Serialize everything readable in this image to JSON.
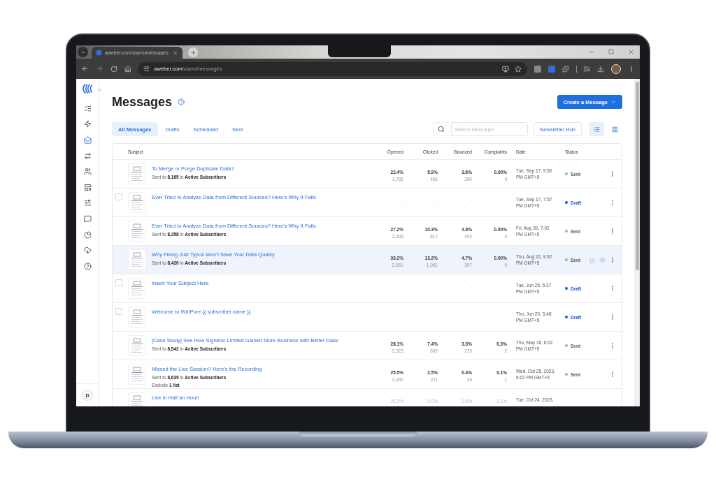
{
  "browser": {
    "tab_title": "aweber.com/users/messages",
    "url_host": "aweber.com",
    "url_path": "/users/messages"
  },
  "sidebar": {
    "items": [
      {
        "selected": false
      },
      {
        "selected": false
      },
      {
        "selected": true
      },
      {
        "selected": false
      },
      {
        "selected": false
      },
      {
        "selected": false
      },
      {
        "selected": false
      },
      {
        "selected": false
      },
      {
        "selected": false
      },
      {
        "selected": false
      },
      {
        "selected": false
      }
    ],
    "avatar": "D"
  },
  "page": {
    "title": "Messages",
    "create_button": "Create a Message"
  },
  "tabs": [
    {
      "label": "All Messages",
      "selected": true
    },
    {
      "label": "Drafts",
      "selected": false
    },
    {
      "label": "Scheduled",
      "selected": false
    },
    {
      "label": "Sent",
      "selected": false
    }
  ],
  "search": {
    "placeholder": "Search Messages"
  },
  "newsletter_button": "Newsletter Hub",
  "view_toggle": [
    {
      "kind": "list",
      "selected": true
    },
    {
      "kind": "grid",
      "selected": false
    }
  ],
  "table": {
    "columns": [
      "Subject",
      "Opened",
      "Clicked",
      "Bounced",
      "Complaints",
      "Date",
      "Status"
    ],
    "rows": [
      {
        "subject": "To Merge or Purge Duplicate Data?",
        "sent_to": "Sent to **8,165** in **Active Subscribers**",
        "stats": [
          {
            "rate": "22.4%",
            "count": "1,765"
          },
          {
            "rate": "5.9%",
            "count": "465"
          },
          {
            "rate": "3.6%",
            "count": "290"
          },
          {
            "rate": "0.00%",
            "count": "0"
          }
        ],
        "date": "Tue, Sep 17, 9:30 PM GMT+5",
        "status": {
          "label": "Sent",
          "kind": "sent",
          "color": "#6fcf97"
        },
        "highlighted": false
      },
      {
        "subject": "Ever Tried to Analyze Data from Different Sources? Here's Why It Fails",
        "checked": false,
        "stats": [
          {
            "rate": "-"
          },
          {
            "rate": "-"
          },
          {
            "rate": "-"
          },
          {
            "rate": "-"
          }
        ],
        "date": "Tue, Sep 17, 7:57 PM GMT+5",
        "status": {
          "label": "Draft",
          "kind": "draft",
          "color": "#1a56d6"
        },
        "highlighted": false
      },
      {
        "subject": "Ever Tried to Analyze Data from Different Sources? Here's Why It Fails",
        "sent_to": "Sent to **8,358** in **Active Subscribers**",
        "stats": [
          {
            "rate": "27.2%",
            "count": "2,165"
          },
          {
            "rate": "10.3%",
            "count": "817"
          },
          {
            "rate": "4.8%",
            "count": "403"
          },
          {
            "rate": "0.00%",
            "count": "0"
          }
        ],
        "date": "Fri, Aug 30, 7:02 PM GMT+5",
        "status": {
          "label": "Sent",
          "kind": "sent",
          "color": "#6fcf97"
        },
        "highlighted": false
      },
      {
        "subject": "Why Fixing Just Typos Won’t Save Your Data Quality",
        "sent_to": "Sent to **8,420** in **Active Subscribers**",
        "stats": [
          {
            "rate": "33.2%",
            "count": "2,661"
          },
          {
            "rate": "13.2%",
            "count": "1,062"
          },
          {
            "rate": "4.7%",
            "count": "397"
          },
          {
            "rate": "0.00%",
            "count": "0"
          }
        ],
        "date": "Thu, Aug 22, 9:32 PM GMT+5",
        "status": {
          "label": "Sent",
          "kind": "sent",
          "color": "#6fcf97"
        },
        "highlighted": true
      },
      {
        "subject": "Insert Your Subject Here",
        "checked": false,
        "stats": [
          {
            "rate": "-"
          },
          {
            "rate": "-"
          },
          {
            "rate": "-"
          },
          {
            "rate": "-"
          }
        ],
        "date": "Tue, Jun 25, 5:37 PM GMT+5",
        "status": {
          "label": "Draft",
          "kind": "draft",
          "color": "#1a56d6"
        },
        "highlighted": false
      },
      {
        "subject": "Welcome to WinPure {{ subscriber.name }}",
        "checked": false,
        "stats": [
          {
            "rate": "-"
          },
          {
            "rate": "-"
          },
          {
            "rate": "-"
          },
          {
            "rate": "-"
          }
        ],
        "date": "Thu, Jun 20, 5:48 PM GMT+5",
        "status": {
          "label": "Draft",
          "kind": "draft",
          "color": "#1a56d6"
        },
        "highlighted": false
      },
      {
        "subject": "[Case Study] See How Signetor Limited Gained More Business with Better Data!",
        "sent_to": "Sent to **8,542** in **Active Subscribers**",
        "stats": [
          {
            "rate": "28.1%",
            "count": "2,323"
          },
          {
            "rate": "7.4%",
            "count": "609"
          },
          {
            "rate": "3.3%",
            "count": "279"
          },
          {
            "rate": "0.3%",
            "count": "2"
          }
        ],
        "date": "Thu, May 16, 6:02 PM GMT+5",
        "status": {
          "label": "Sent",
          "kind": "sent",
          "color": "#6fcf97"
        },
        "highlighted": false
      },
      {
        "subject": "Missed the Live Session? Here's the Recording",
        "sent_to": "Sent to **8,639** in **Active Subscribers**",
        "note": "Exclude **1 list**",
        "stats": [
          {
            "rate": "25.5%",
            "count": "2,190"
          },
          {
            "rate": "2.5%",
            "count": "211"
          },
          {
            "rate": "0.4%",
            "count": "36"
          },
          {
            "rate": "0.1%",
            "count": "1"
          }
        ],
        "date": "Wed, Oct 25, 2023, 6:02 PM GMT+5",
        "status": {
          "label": "Sent",
          "kind": "sent",
          "color": "#6fcf97"
        },
        "highlighted": false
      },
      {
        "subject": "Live in Half an Hour!",
        "stats": [
          {
            "rate": "25.3%"
          },
          {
            "rate": "0.0%"
          },
          {
            "rate": "0.5%"
          },
          {
            "rate": "0.1%"
          }
        ],
        "date": "Tue, Oct 24, 2023,",
        "highlighted": false
      }
    ]
  }
}
